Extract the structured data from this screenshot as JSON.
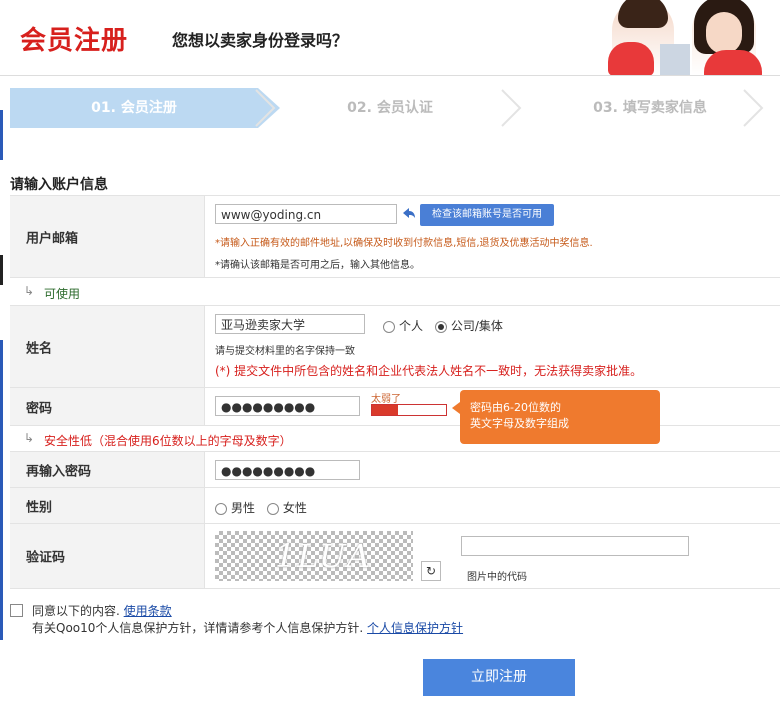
{
  "header": {
    "title": "会员注册",
    "subtitle": "您想以卖家身份登录吗？"
  },
  "steps": [
    {
      "label": "01. 会员注册"
    },
    {
      "label": "02. 会员认证"
    },
    {
      "label": "03. 填写卖家信息"
    }
  ],
  "form": {
    "section_title": "请输入账户信息",
    "email": {
      "label": "用户邮箱",
      "value": "www@yoding.cn",
      "check_button": "检查该邮箱账号是否可用",
      "note1": "*请输入正确有效的邮件地址,以确保及时收到付款信息,短信,退货及优惠活动中奖信息.",
      "note2": "*请确认该邮箱是否可用之后，输入其他信息。",
      "status": "可使用"
    },
    "name": {
      "label": "姓名",
      "value": "亚马逊卖家大学",
      "opt_personal": "个人",
      "opt_company": "公司/集体",
      "note1": "请与提交材料里的名字保持一致",
      "note2": "(*) 提交文件中所包含的姓名和企业代表法人姓名不一致时，无法获得卖家批准。"
    },
    "password": {
      "label": "密码",
      "value": "●●●●●●●●●",
      "strength_label": "太弱了",
      "strength": 0.35,
      "tooltip_line1": "密码由6-20位数的",
      "tooltip_line2": "英文字母及数字组成",
      "status": "安全性低（混合使用6位数以上的字母及数字）"
    },
    "password_confirm": {
      "label": "再输入密码",
      "value": "●●●●●●●●●"
    },
    "gender": {
      "label": "性别",
      "male": "男性",
      "female": "女性"
    },
    "captcha": {
      "label": "验证码",
      "image_text": "1LUA",
      "input_value": "",
      "hint": "图片中的代码"
    }
  },
  "agree": {
    "line1_prefix": "同意以下的内容.",
    "terms_link": "使用条款",
    "line2_prefix": "有关Qoo10个人信息保护方针，详情请参考个人信息保护方针.",
    "privacy_link": "个人信息保护方针"
  },
  "submit_label": "立即注册",
  "colors": {
    "accent_red": "#d7201d",
    "step_active": "#bcd9f2",
    "button_blue": "#4a85dd",
    "tooltip_orange": "#ef7a2e"
  }
}
